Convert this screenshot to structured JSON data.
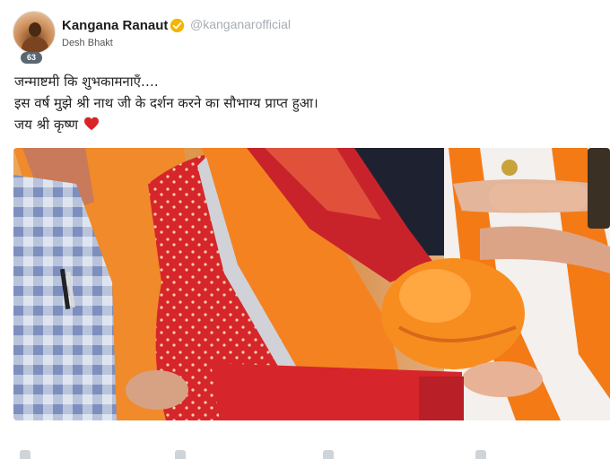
{
  "author": {
    "name": "Kangana Ranaut",
    "handle": "@kanganarofficial",
    "bio": "Desh Bhakt",
    "avatar_badge": "63",
    "verified_color": "#f4b400",
    "verified_icon": "verified-check-icon"
  },
  "post": {
    "lines": [
      "जन्माष्टमी कि शुभकामनाएँ….",
      "इस वर्ष मुझे श्री नाथ जी के दर्शन करने का सौभाग्य प्राप्त हुआ।",
      "जय श्री कृष्ण"
    ],
    "emoji_icon": "red-heart-icon"
  },
  "photo": {
    "icon": "photo-image",
    "description_colors": {
      "saffron": "#f07a1e",
      "red": "#d52a2a"
    }
  },
  "actions": {
    "icons": [
      "like-icon",
      "comment-icon",
      "share-icon",
      "more-icon"
    ]
  }
}
